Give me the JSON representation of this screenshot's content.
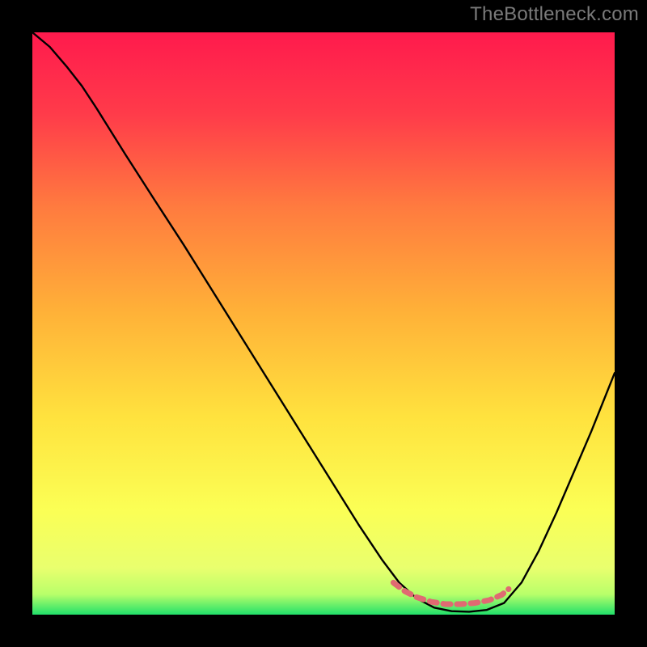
{
  "watermark": "TheBottleneck.com",
  "chart_data": {
    "note": "Axis units not labeled in source image. x and y are normalized 0–1 within the plot area; y is plotted with 0 at bottom. curve_black is the thin black line, curve_red is the short red/pink segment near the valley floor.",
    "type": "line",
    "title": "",
    "xlabel": "",
    "ylabel": "",
    "xlim": [
      0,
      1
    ],
    "ylim": [
      0,
      1
    ],
    "gradient_stops": [
      {
        "offset": 0.0,
        "color": "#ff1a4d"
      },
      {
        "offset": 0.14,
        "color": "#ff3b4a"
      },
      {
        "offset": 0.3,
        "color": "#ff7b3f"
      },
      {
        "offset": 0.48,
        "color": "#ffb138"
      },
      {
        "offset": 0.66,
        "color": "#ffe23e"
      },
      {
        "offset": 0.82,
        "color": "#fbff55"
      },
      {
        "offset": 0.92,
        "color": "#e9ff6e"
      },
      {
        "offset": 0.965,
        "color": "#b8ff6a"
      },
      {
        "offset": 1.0,
        "color": "#21e06a"
      }
    ],
    "series": [
      {
        "name": "curve_black",
        "color": "#000000",
        "points": [
          {
            "x": 0.0,
            "y": 1.0
          },
          {
            "x": 0.03,
            "y": 0.975
          },
          {
            "x": 0.06,
            "y": 0.94
          },
          {
            "x": 0.085,
            "y": 0.908
          },
          {
            "x": 0.11,
            "y": 0.87
          },
          {
            "x": 0.16,
            "y": 0.79
          },
          {
            "x": 0.21,
            "y": 0.712
          },
          {
            "x": 0.26,
            "y": 0.635
          },
          {
            "x": 0.31,
            "y": 0.555
          },
          {
            "x": 0.36,
            "y": 0.475
          },
          {
            "x": 0.41,
            "y": 0.395
          },
          {
            "x": 0.46,
            "y": 0.315
          },
          {
            "x": 0.51,
            "y": 0.235
          },
          {
            "x": 0.56,
            "y": 0.155
          },
          {
            "x": 0.6,
            "y": 0.095
          },
          {
            "x": 0.63,
            "y": 0.055
          },
          {
            "x": 0.66,
            "y": 0.028
          },
          {
            "x": 0.69,
            "y": 0.012
          },
          {
            "x": 0.72,
            "y": 0.006
          },
          {
            "x": 0.75,
            "y": 0.005
          },
          {
            "x": 0.78,
            "y": 0.008
          },
          {
            "x": 0.81,
            "y": 0.02
          },
          {
            "x": 0.84,
            "y": 0.055
          },
          {
            "x": 0.87,
            "y": 0.11
          },
          {
            "x": 0.9,
            "y": 0.175
          },
          {
            "x": 0.93,
            "y": 0.245
          },
          {
            "x": 0.96,
            "y": 0.315
          },
          {
            "x": 0.99,
            "y": 0.39
          },
          {
            "x": 1.0,
            "y": 0.415
          }
        ]
      },
      {
        "name": "curve_red",
        "color": "#e06a72",
        "points": [
          {
            "x": 0.62,
            "y": 0.055
          },
          {
            "x": 0.64,
            "y": 0.04
          },
          {
            "x": 0.66,
            "y": 0.03
          },
          {
            "x": 0.685,
            "y": 0.022
          },
          {
            "x": 0.71,
            "y": 0.018
          },
          {
            "x": 0.735,
            "y": 0.018
          },
          {
            "x": 0.76,
            "y": 0.02
          },
          {
            "x": 0.785,
            "y": 0.025
          },
          {
            "x": 0.806,
            "y": 0.034
          },
          {
            "x": 0.818,
            "y": 0.044
          }
        ]
      }
    ]
  }
}
